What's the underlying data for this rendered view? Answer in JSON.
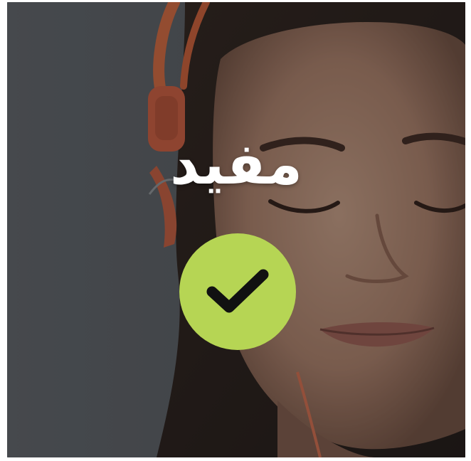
{
  "status": {
    "label": "مفيد",
    "icon": "checkmark-icon",
    "badge_color": "#b6d554",
    "icon_color": "#111111"
  },
  "background": {
    "subject": "woman-with-orange-headphones-photo",
    "overlay_color": "#2a2a2a"
  }
}
